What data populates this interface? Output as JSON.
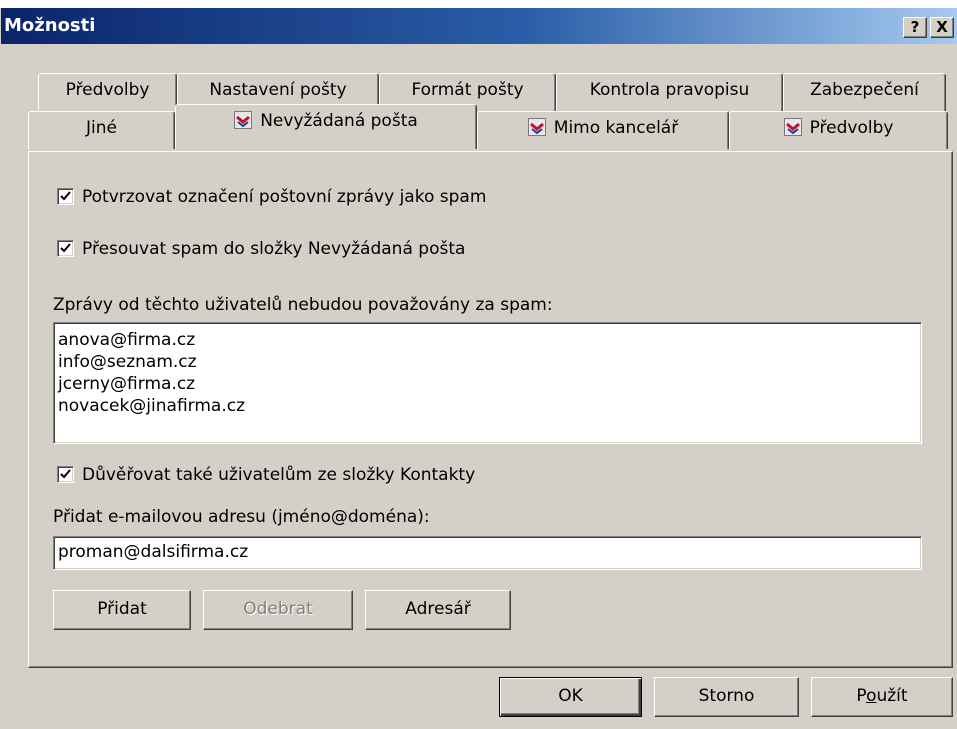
{
  "window": {
    "title": "Možnosti",
    "help_label": "?",
    "close_label": "X"
  },
  "tabs_row1": [
    {
      "label": "Předvolby"
    },
    {
      "label": "Nastavení pošty"
    },
    {
      "label": "Formát pošty"
    },
    {
      "label": "Kontrola pravopisu"
    },
    {
      "label": "Zabezpečení"
    }
  ],
  "tabs_row2": [
    {
      "label": "Jiné"
    },
    {
      "label": "Nevyžádaná pošta",
      "icon": "addin-icon"
    },
    {
      "label": "Mimo kancelář",
      "icon": "addin-icon"
    },
    {
      "label": "Předvolby",
      "icon": "addin-icon"
    }
  ],
  "options": {
    "confirm_spam": {
      "label": "Potvrzovat označení poštovní zprávy jako spam",
      "checked": true
    },
    "move_spam": {
      "label": "Přesouvat spam do složky Nevyžádaná pošta",
      "checked": true
    },
    "trusted_label": "Zprávy od těchto uživatelů nebudou považovány za spam:",
    "trusted_list": [
      "anova@firma.cz",
      "info@seznam.cz",
      "jcerny@firma.cz",
      "novacek@jinafirma.cz"
    ],
    "trust_contacts": {
      "label": "Důvěřovat také uživatelům ze složky Kontakty",
      "checked": true
    },
    "add_label": "Přidat e-mailovou adresu (jméno@doména):",
    "add_value": "proman@dalsifirma.cz"
  },
  "panel_buttons": {
    "add": "Přidat",
    "remove": "Odebrat",
    "addressbook": "Adresář"
  },
  "dialog_buttons": {
    "ok": "OK",
    "cancel": "Storno",
    "apply_pre": "P",
    "apply_u": "o",
    "apply_post": "užít"
  },
  "colors": {
    "title_start": "#0a246a",
    "title_end": "#a6caf0",
    "face": "#d4d0c8"
  }
}
